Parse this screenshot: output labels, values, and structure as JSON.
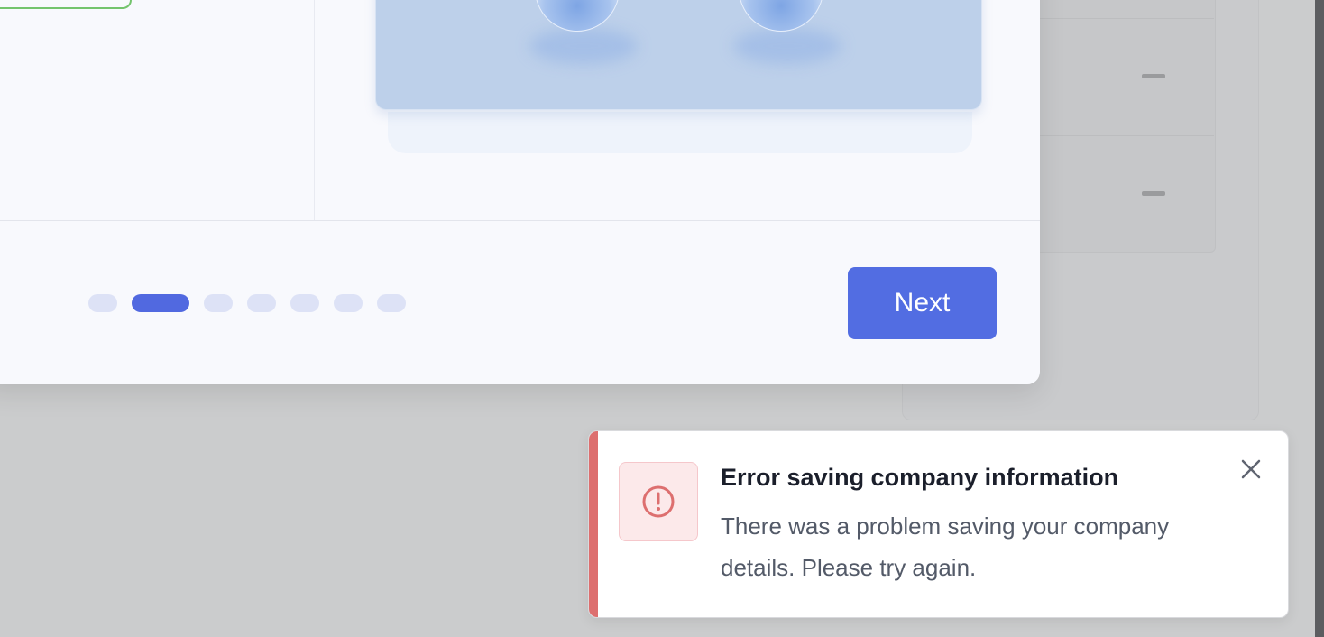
{
  "wizard": {
    "next_label": "Next",
    "steps": {
      "total": 7,
      "current": 2
    },
    "accent_color": "#526de2"
  },
  "toast": {
    "type": "error",
    "title": "Error saving company information",
    "message": "There was a problem saving your company details. Please try again.",
    "accent_color": "#dd6f6f",
    "icon": "alert-circle-icon",
    "close_icon": "close-icon"
  }
}
